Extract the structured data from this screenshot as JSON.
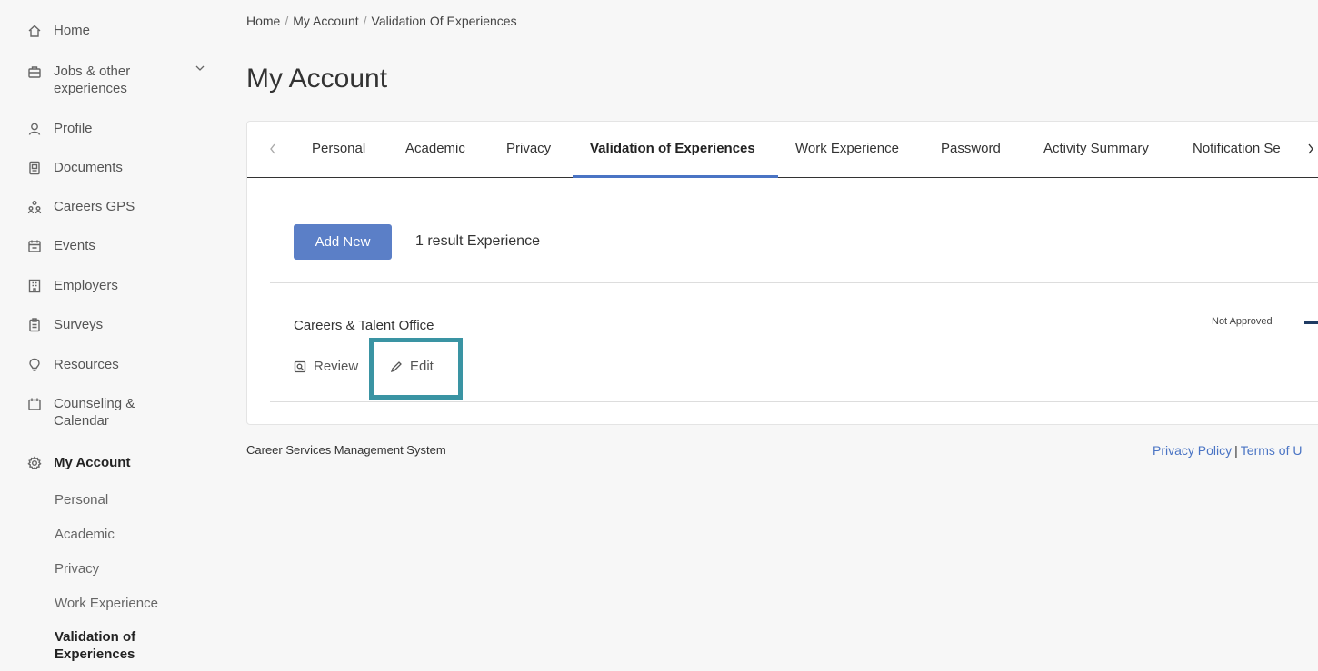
{
  "sidebar": {
    "items": [
      {
        "label": "Home",
        "icon": "home-icon"
      },
      {
        "label": "Jobs & other experiences",
        "icon": "briefcase-icon"
      },
      {
        "label": "Profile",
        "icon": "user-icon"
      },
      {
        "label": "Documents",
        "icon": "document-icon"
      },
      {
        "label": "Careers GPS",
        "icon": "people-icon"
      },
      {
        "label": "Events",
        "icon": "calendar-event-icon"
      },
      {
        "label": "Employers",
        "icon": "building-icon"
      },
      {
        "label": "Surveys",
        "icon": "clipboard-icon"
      },
      {
        "label": "Resources",
        "icon": "lightbulb-icon"
      },
      {
        "label": "Counseling & Calendar",
        "icon": "calendar-icon"
      },
      {
        "label": "My Account",
        "icon": "gear-icon"
      }
    ],
    "sub_items": [
      "Personal",
      "Academic",
      "Privacy",
      "Work Experience",
      "Validation of Experiences"
    ]
  },
  "breadcrumb": [
    "Home",
    "My Account",
    "Validation Of Experiences"
  ],
  "breadcrumb_sep": "/",
  "page_title": "My Account",
  "tabs": [
    "Personal",
    "Academic",
    "Privacy",
    "Validation of Experiences",
    "Work Experience",
    "Password",
    "Activity Summary",
    "Notification Se"
  ],
  "add_button": "Add New",
  "result_count": "1 result Experience",
  "experience": {
    "name": "Careers & Talent Office",
    "status": "Not Approved",
    "review_label": "Review",
    "edit_label": "Edit"
  },
  "footer": {
    "left": "Career Services Management System",
    "privacy": "Privacy Policy",
    "separator": "|",
    "terms": "Terms of U"
  },
  "colors": {
    "accent": "#5b7fc7",
    "highlight": "#3a94a3",
    "status_bar": "#1f3b63"
  }
}
